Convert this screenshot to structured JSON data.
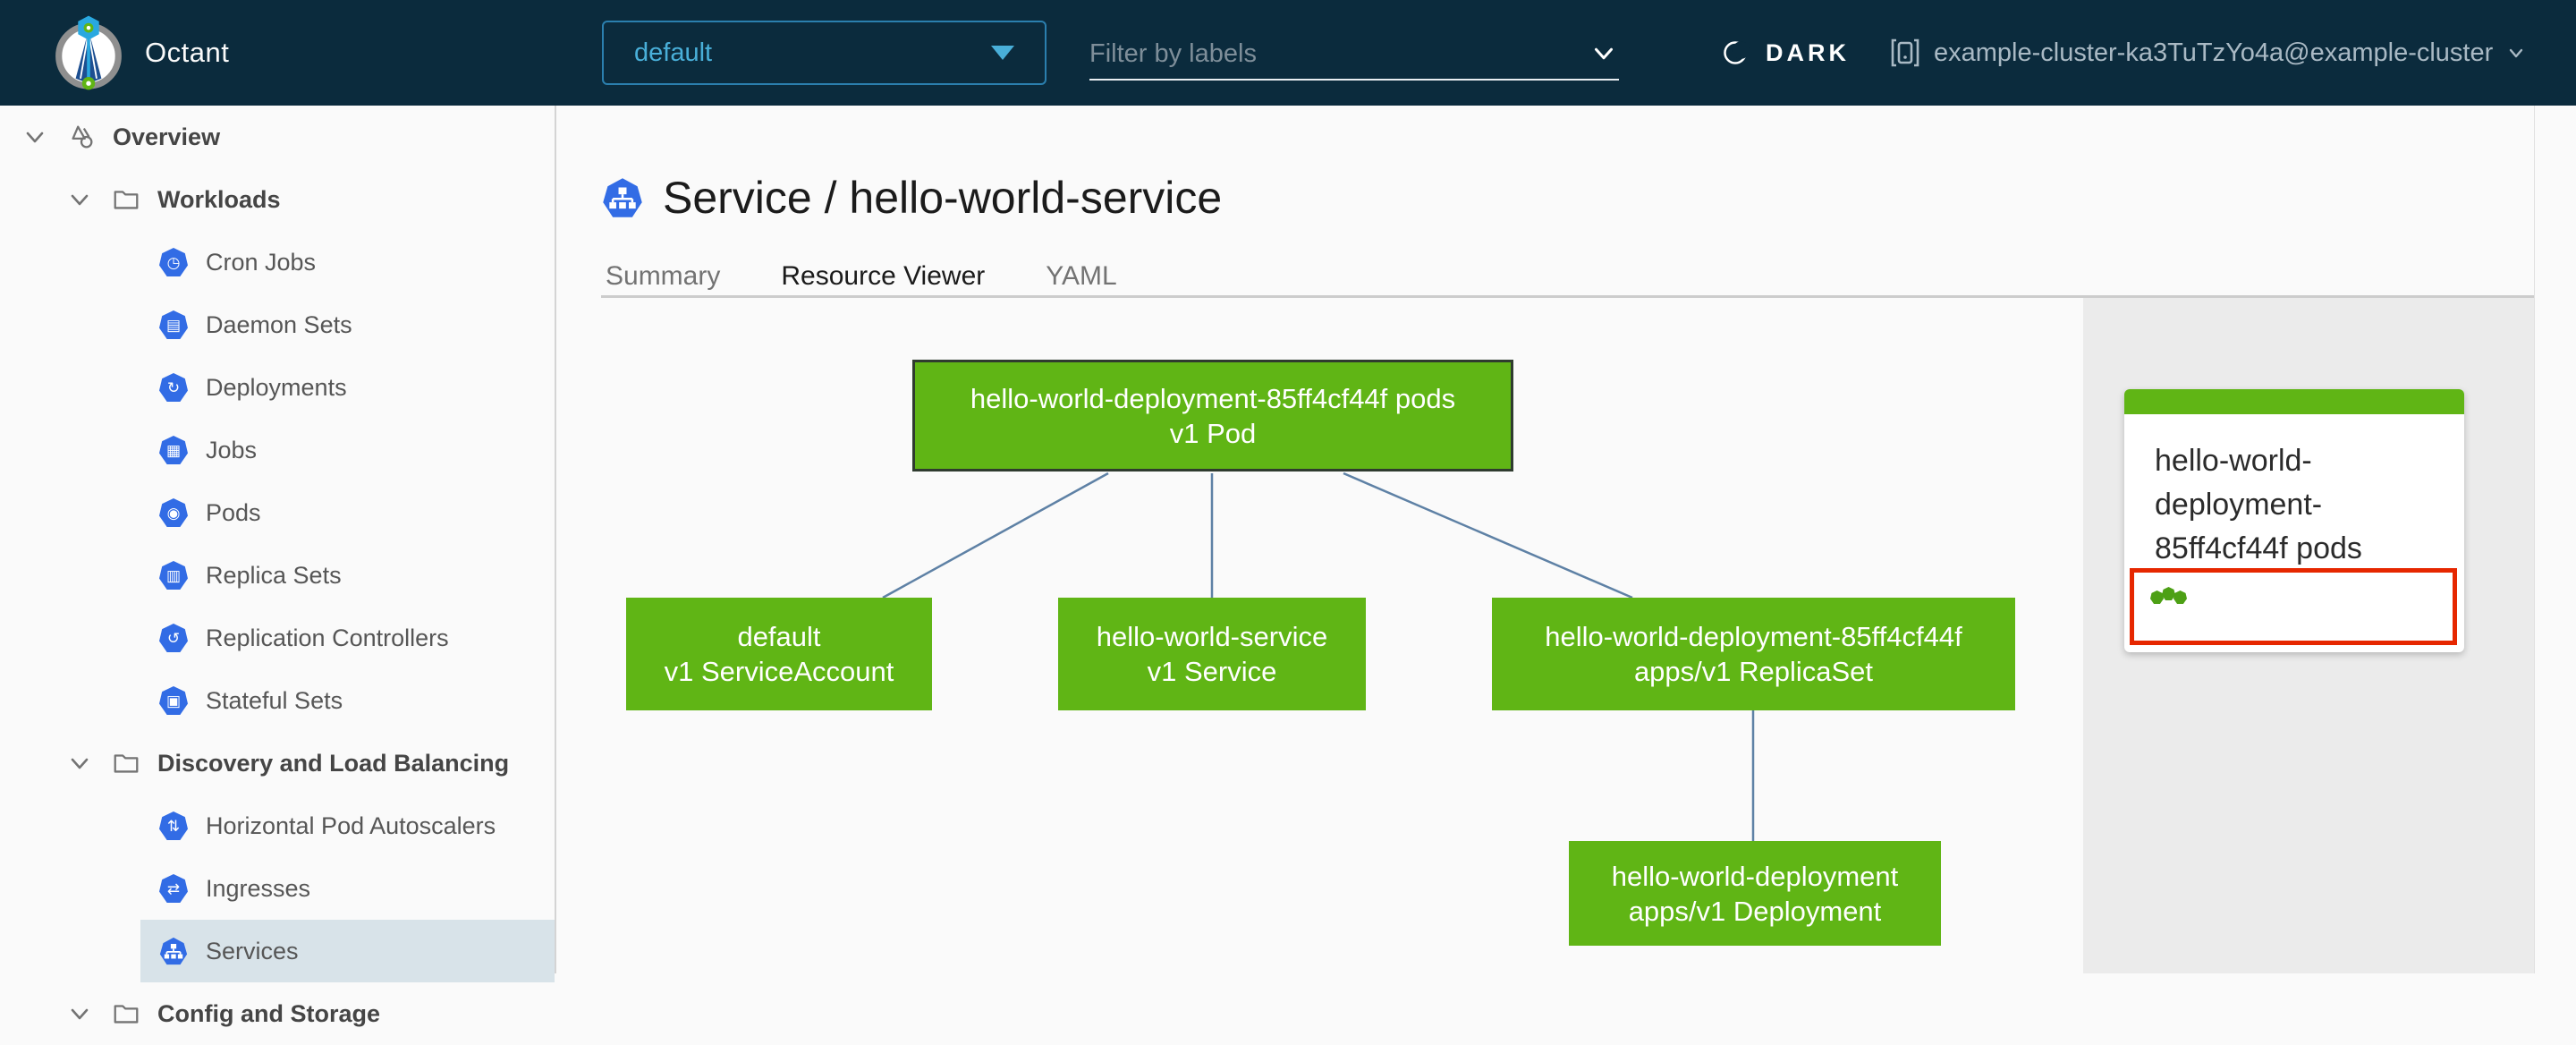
{
  "header": {
    "app_title": "Octant",
    "namespace_selector": {
      "value": "default"
    },
    "filter": {
      "placeholder": "Filter by labels"
    },
    "theme_toggle": {
      "label": "DARK",
      "icon": "moon-icon"
    },
    "cluster": {
      "label": "example-cluster-ka3TuTzYo4a@example-cluster",
      "icon": "cluster-context-icon"
    }
  },
  "sidebar": {
    "items": [
      {
        "label": "Overview",
        "icon": "overview-icon",
        "level": 0,
        "expanded": true
      },
      {
        "label": "Workloads",
        "icon": "folder-icon",
        "level": 1,
        "expanded": true
      },
      {
        "label": "Cron Jobs",
        "icon": "cronjobs-icon",
        "level": 2
      },
      {
        "label": "Daemon Sets",
        "icon": "daemonsets-icon",
        "level": 2
      },
      {
        "label": "Deployments",
        "icon": "deployments-icon",
        "level": 2
      },
      {
        "label": "Jobs",
        "icon": "jobs-icon",
        "level": 2
      },
      {
        "label": "Pods",
        "icon": "pods-icon",
        "level": 2
      },
      {
        "label": "Replica Sets",
        "icon": "replicasets-icon",
        "level": 2
      },
      {
        "label": "Replication Controllers",
        "icon": "replicationcontrollers-icon",
        "level": 2
      },
      {
        "label": "Stateful Sets",
        "icon": "statefulsets-icon",
        "level": 2
      },
      {
        "label": "Discovery and Load Balancing",
        "icon": "folder-icon",
        "level": 1,
        "expanded": true
      },
      {
        "label": "Horizontal Pod Autoscalers",
        "icon": "hpa-icon",
        "level": 2
      },
      {
        "label": "Ingresses",
        "icon": "ingresses-icon",
        "level": 2
      },
      {
        "label": "Services",
        "icon": "services-icon",
        "level": 2,
        "selected": true
      },
      {
        "label": "Config and Storage",
        "icon": "folder-icon",
        "level": 1,
        "expanded": true
      }
    ]
  },
  "main": {
    "title": "Service / hello-world-service",
    "title_icon": "service-icon",
    "tabs": [
      {
        "label": "Summary",
        "active": false
      },
      {
        "label": "Resource Viewer",
        "active": true
      },
      {
        "label": "YAML",
        "active": false
      }
    ]
  },
  "graph": {
    "nodes": [
      {
        "id": "pod",
        "line1": "hello-world-deployment-85ff4cf44f pods",
        "line2": "v1 Pod",
        "selected": true
      },
      {
        "id": "serviceaccount",
        "line1": "default",
        "line2": "v1 ServiceAccount",
        "selected": false
      },
      {
        "id": "service",
        "line1": "hello-world-service",
        "line2": "v1 Service",
        "selected": false
      },
      {
        "id": "replicaset",
        "line1": "hello-world-deployment-85ff4cf44f",
        "line2": "apps/v1 ReplicaSet",
        "selected": false
      },
      {
        "id": "deployment",
        "line1": "hello-world-deployment",
        "line2": "apps/v1 Deployment",
        "selected": false
      }
    ],
    "edges": [
      {
        "from": "pod",
        "to": "serviceaccount"
      },
      {
        "from": "pod",
        "to": "service"
      },
      {
        "from": "pod",
        "to": "replicaset"
      },
      {
        "from": "replicaset",
        "to": "deployment"
      }
    ]
  },
  "panel": {
    "card": {
      "title": "hello-world-deployment-85ff4cf44f pods",
      "status_dot_count": 3
    }
  },
  "colors": {
    "header_bg": "#0b2b3d",
    "accent_blue": "#49afd9",
    "k8s_blue": "#326ce5",
    "node_green": "#60b515",
    "status_dot_green": "#4da015",
    "selection_red": "#e62700",
    "active_tab_blue": "#0079b8",
    "edge_blue": "#5e81a5",
    "selected_row_bg": "#d8e3e9"
  }
}
